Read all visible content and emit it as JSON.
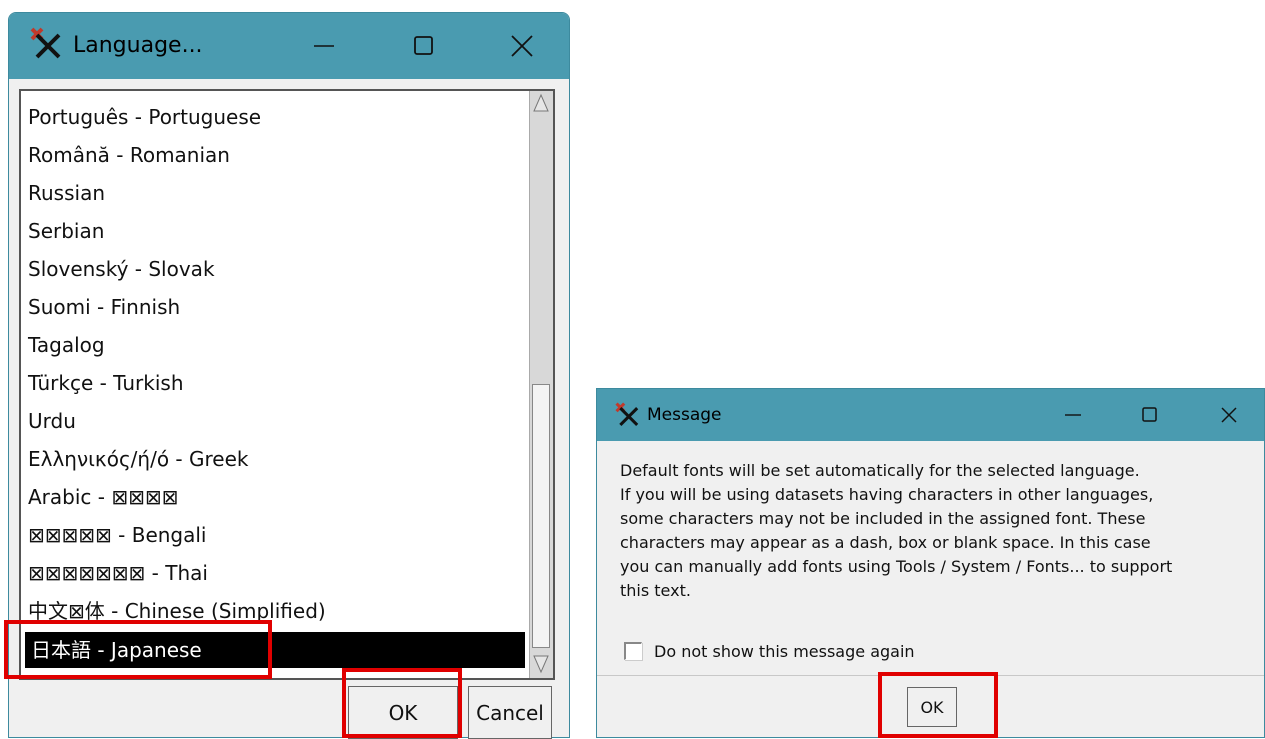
{
  "language_dialog": {
    "title": "Language...",
    "items": [
      "Português - Portuguese",
      "Română - Romanian",
      "Russian",
      "Serbian",
      "Slovenský - Slovak",
      "Suomi - Finnish",
      "Tagalog",
      "Türkçe - Turkish",
      "Urdu",
      "Ελληνικός/ή/ό - Greek",
      "Arabic - ⊠⊠⊠⊠",
      "⊠⊠⊠⊠⊠ - Bengali",
      "⊠⊠⊠⊠⊠⊠⊠ - Thai",
      "中文⊠体 - Chinese (Simplified)",
      "日本語 - Japanese"
    ],
    "selected_item": "日本語 - Japanese",
    "ok_label": "OK",
    "cancel_label": "Cancel"
  },
  "message_dialog": {
    "title": "Message",
    "lines": [
      "Default fonts will be set automatically for the selected language.",
      "If you will be using datasets having characters in other languages,",
      "some characters may not be included in the assigned font. These",
      "characters may appear as a dash, box or blank space. In this case",
      "you can manually add fonts using Tools / System / Fonts... to support",
      "this text."
    ],
    "checkbox_label": "Do not show this message again",
    "checkbox_checked": false,
    "ok_label": "OK"
  },
  "colors": {
    "titlebar": "#4a9bb0",
    "highlight": "#e00000",
    "selection": "#000000"
  },
  "icons": [
    "app-icon",
    "minimize-icon",
    "maximize-icon",
    "close-icon",
    "scroll-up-icon",
    "scroll-down-icon"
  ]
}
